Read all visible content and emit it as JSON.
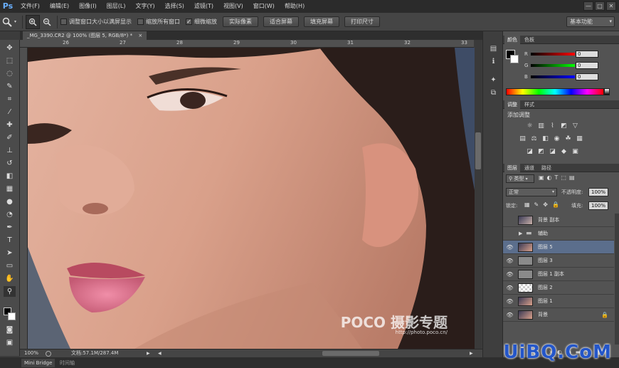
{
  "app": {
    "logo": "Ps"
  },
  "menubar": {
    "items": [
      "文件(F)",
      "编辑(E)",
      "图像(I)",
      "图层(L)",
      "文字(Y)",
      "选择(S)",
      "滤镜(T)",
      "视图(V)",
      "窗口(W)",
      "帮助(H)"
    ]
  },
  "window_controls": {
    "minimize": "—",
    "maximize": "□",
    "close": "✕"
  },
  "options": {
    "check1": "调整窗口大小以满屏显示",
    "check2": "缩放所有窗口",
    "check3": "细微缩放",
    "check3_checked": true,
    "btn_actual": "实际像素",
    "btn_fit": "适合屏幕",
    "btn_fill": "填充屏幕",
    "btn_print": "打印尺寸",
    "workspace": "基本功能"
  },
  "document": {
    "tab_title": "_MG_3390.CR2 @ 100% (图层 5, RGB/8*) *",
    "tab_close": "×",
    "zoom": "100%",
    "doc_info": "文档:57.1M/287.4M"
  },
  "ruler": {
    "top_numbers": [
      "26",
      "27",
      "28",
      "29",
      "30",
      "31",
      "32",
      "33"
    ]
  },
  "minibridge": {
    "tab1": "Mini Bridge",
    "tab2": "时间轴"
  },
  "watermark": {
    "text": "UiBQ.CoM",
    "poco": "POCO 摄影专题",
    "poco_url": "http://photo.poco.cn/"
  },
  "color_panel": {
    "tab_color": "颜色",
    "tab_swatches": "色板",
    "r_label": "R",
    "g_label": "G",
    "b_label": "B",
    "r_value": "0",
    "g_value": "0",
    "b_value": "0"
  },
  "adjust_panel": {
    "tab_adjust": "调整",
    "tab_styles": "样式",
    "title": "添加调整"
  },
  "layers_panel": {
    "tab_layers": "图层",
    "tab_channels": "通道",
    "tab_paths": "路径",
    "kind": "类型",
    "blend_mode": "正常",
    "opacity_label": "不透明度:",
    "opacity_value": "100%",
    "lock_label": "锁定:",
    "fill_label": "填充:",
    "fill_value": "100%",
    "layers": [
      {
        "name": "背景 副本",
        "visible": false,
        "thumb": "photo"
      },
      {
        "name": "辅助",
        "visible": false,
        "thumb": "folder"
      },
      {
        "name": "图层 5",
        "visible": true,
        "thumb": "photo",
        "selected": true
      },
      {
        "name": "图层 3",
        "visible": true,
        "thumb": "gray"
      },
      {
        "name": "图层 1 副本",
        "visible": true,
        "thumb": "gray"
      },
      {
        "name": "图层 2",
        "visible": true,
        "thumb": "transparent"
      },
      {
        "name": "图层 1",
        "visible": true,
        "thumb": "photo"
      },
      {
        "name": "背景",
        "visible": true,
        "thumb": "photo"
      }
    ]
  }
}
